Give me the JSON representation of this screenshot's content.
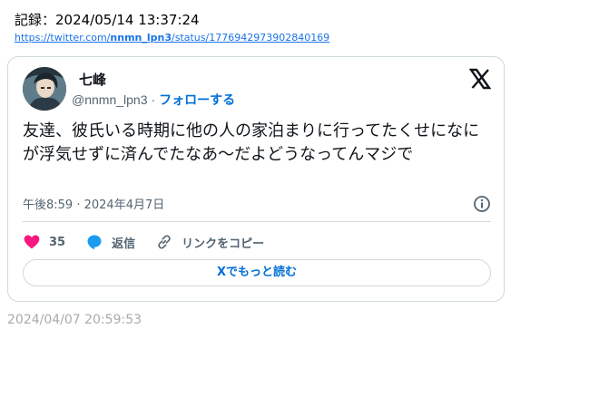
{
  "record": {
    "label": "記録：2024/05/14 13:37:24"
  },
  "url": {
    "prefix": "https://twitter.com/",
    "user": "nnmn_lpn3",
    "suffix": "/status/1776942973902840169"
  },
  "tweet": {
    "display_name": "七峰",
    "handle": "@nnmn_lpn3",
    "separator": "·",
    "follow_label": "フォローする",
    "text": "友達、彼氏いる時期に他の人の家泊まりに行ってたくせになにが浮気せずに済んでたなあ〜だよどうなってんマジで",
    "time": "午後8:59",
    "date": "2024年4月7日",
    "like_count": "35",
    "reply_label": "返信",
    "copy_link_label": "リンクをコピー",
    "read_more_label": "Xでもっと読む"
  },
  "posted_date": "2024/04/07 20:59:53",
  "colors": {
    "link": "#1a73e8",
    "accent": "#006fd6",
    "like": "#f91880",
    "reply": "#1d9bf0",
    "muted": "#536471",
    "border": "#cfd9de"
  },
  "icons": [
    "x-logo-icon",
    "info-icon",
    "heart-icon",
    "reply-bubble-icon",
    "link-icon"
  ]
}
